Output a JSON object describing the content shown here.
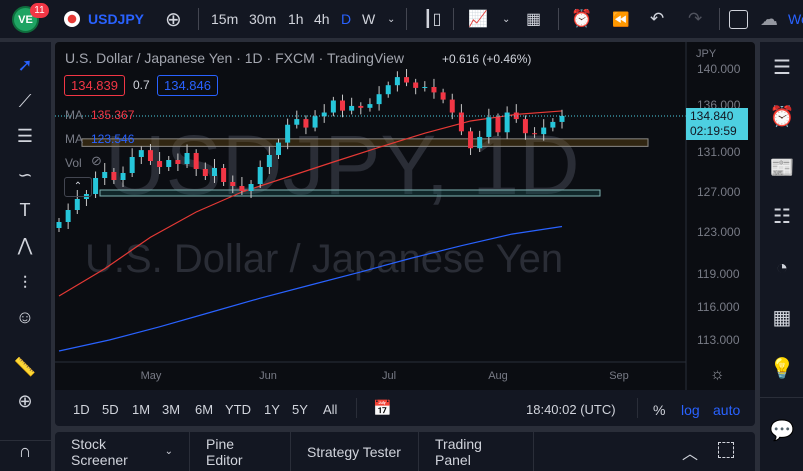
{
  "topbar": {
    "badge_count": "11",
    "symbol": "USDJPY",
    "intervals": [
      "15m",
      "30m",
      "1h",
      "4h",
      "D",
      "W"
    ],
    "active_interval": "D",
    "weather_label": "We"
  },
  "legend": {
    "title": "U.S. Dollar / Japanese Yen · 1D · FXCM · TradingView",
    "change": "+0.616 (+0.46%)",
    "bid": "134.839",
    "spread": "0.7",
    "ask": "134.846",
    "ma1_label": "MA",
    "ma1_value": "135.367",
    "ma2_label": "MA",
    "ma2_value": "123.546",
    "vol_label": "Vol"
  },
  "watermark": {
    "symbol": "USDJPY, 1D",
    "name": "U.S. Dollar / Japanese Yen"
  },
  "price_axis": {
    "currency": "JPY",
    "last_price": "134.840",
    "countdown": "02:19:59"
  },
  "colors": {
    "up": "#26c6da",
    "down": "#f23645",
    "ma1": "#e53935",
    "ma2": "#2962ff",
    "accent": "#2962ff",
    "last": "#4dd0e1"
  },
  "bottom": {
    "ranges": [
      "1D",
      "5D",
      "1M",
      "3M",
      "6M",
      "YTD",
      "1Y",
      "5Y",
      "All"
    ],
    "clock": "18:40:02 (UTC)",
    "percent": "%",
    "log": "log",
    "auto": "auto"
  },
  "panel": {
    "tabs": [
      "Stock Screener",
      "Pine Editor",
      "Strategy Tester",
      "Trading Panel"
    ]
  },
  "chart_data": {
    "type": "candlestick",
    "title": "USDJPY 1D",
    "y_ticks": [
      140,
      136,
      131,
      127,
      123,
      119,
      116,
      113
    ],
    "y_tick_labels": [
      "140.000",
      "136.000",
      "131.000",
      "127.000",
      "123.000",
      "119.000",
      "116.000",
      "113.000"
    ],
    "x_ticks": [
      "May",
      "Jun",
      "Jul",
      "Aug",
      "Sep"
    ],
    "closes": [
      124.0,
      125.2,
      126.3,
      126.8,
      128.4,
      129.0,
      128.2,
      128.9,
      130.5,
      131.2,
      130.1,
      129.5,
      130.2,
      129.8,
      130.9,
      129.3,
      128.6,
      129.4,
      128.0,
      127.6,
      127.1,
      127.8,
      129.5,
      130.7,
      132.0,
      133.9,
      134.5,
      133.6,
      134.8,
      135.2,
      136.5,
      135.4,
      135.9,
      135.7,
      136.1,
      137.2,
      138.2,
      139.1,
      138.5,
      137.9,
      138.0,
      137.4,
      136.6,
      135.2,
      133.2,
      131.4,
      132.6,
      134.7,
      133.1,
      135.2,
      134.5,
      133.0,
      132.9,
      133.6,
      134.2,
      134.84
    ],
    "ma1": [
      117,
      119.5,
      122.5,
      125,
      127,
      128.5,
      130,
      131.5,
      133,
      134.3,
      135.0,
      135.37
    ],
    "ma2": [
      112,
      113,
      114.2,
      115.5,
      116.8,
      118,
      119.2,
      120.5,
      121.7,
      122.8,
      123.55
    ],
    "zones": [
      {
        "low": 131.6,
        "high": 132.4
      },
      {
        "low": 126.6,
        "high": 127.2
      }
    ]
  }
}
